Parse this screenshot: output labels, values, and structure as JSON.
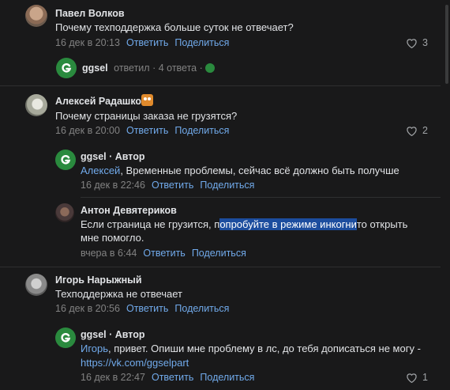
{
  "colors": {
    "background": "#19191a",
    "link": "#71aaeb",
    "muted": "#828282",
    "brand": "#2a8a3e"
  },
  "actions": {
    "reply": "Ответить",
    "share": "Поделиться"
  },
  "comments": [
    {
      "author": "Павел Волков",
      "text": "Почему техподдержка больше суток не отвечает?",
      "date": "16 дек в 20:13",
      "likes": "3",
      "thread_summary": {
        "author": "ggsel",
        "answered": "ответил",
        "count": "4 ответа"
      }
    },
    {
      "author": "Алексей Радашко",
      "badge_icon": "owl-icon",
      "text": "Почему страницы заказа не грузятся?",
      "date": "16 дек в 20:00",
      "likes": "2",
      "replies": [
        {
          "author": "ggsel · Автор",
          "mention": "Алексей",
          "text": ", Временные проблемы, сейчас всё должно быть получше",
          "date": "16 дек в 22:46"
        },
        {
          "author": "Антон Девятериков",
          "text_before": "Если страница не грузится, п",
          "text_highlight": "опробуйте в режиме инкогни",
          "text_after": "то открыть",
          "text_line2": "мне помогло.",
          "date": "вчера в 6:44"
        }
      ]
    },
    {
      "author": "Игорь Нарыжный",
      "text": "Техподдержка не отвечает",
      "date": "16 дек в 20:56",
      "replies": [
        {
          "author": "ggsel · Автор",
          "mention": "Игорь",
          "text": ", привет. Опиши мне проблему в лс, до тебя дописаться не могу -",
          "link": "https://vk.com/ggselpart",
          "date": "16 дек в 22:47",
          "likes": "1"
        }
      ]
    }
  ]
}
